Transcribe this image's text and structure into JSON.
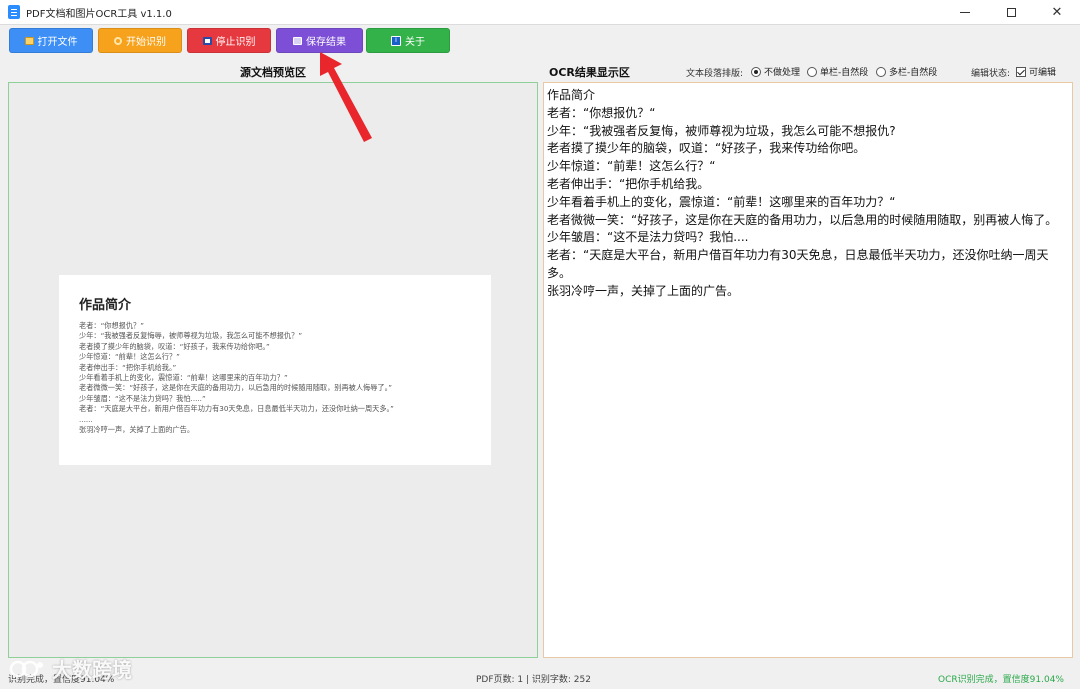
{
  "window": {
    "title": "PDF文档和图片OCR工具 v1.1.0"
  },
  "toolbar": {
    "open_label": "打开文件",
    "start_label": "开始识别",
    "stop_label": "停止识别",
    "save_label": "保存结果",
    "about_label": "关于"
  },
  "left_panel": {
    "title": "源文档预览区"
  },
  "right_panel": {
    "title": "OCR结果显示区",
    "paragraph_label": "文本段落排版:",
    "options": [
      "不做处理",
      "单栏-自然段",
      "多栏-自然段"
    ],
    "selected_option": "不做处理",
    "edit_label": "编辑状态:",
    "editable_label": "可编辑",
    "editable_checked": true,
    "lines": [
      "作品简介",
      "老者：“你想报仇？“",
      "少年：“我被强者反复悔，被师尊视为垃圾，我怎么可能不想报仇?",
      "老者摸了摸少年的脑袋，叹道：“好孩子，我来传功给你吧。",
      "少年惊道：“前辈！这怎么行？“",
      "老者伸出手：“把你手机给我。",
      "少年看着手机上的变化，震惊道：“前辈！这哪里来的百年功力？“",
      "老者微微一笑：“好孩子，这是你在天庭的备用功力，以后急用的时候随用随取，别再被人悔了。",
      "少年皱眉：“这不是法力贷吗？我怕....",
      "老者：“天庭是大平台，新用户借百年功力有30天免息，日息最低半天功力，还没你吐纳一周天多。",
      "张羽冷哼一声，关掉了上面的广告。"
    ]
  },
  "preview_doc": {
    "title": "作品简介",
    "lines": [
      "老者：“你想报仇？”",
      "少年：“我被强者反复悔辱，被师尊视为垃圾，我怎么可能不想报仇？”",
      "老者摸了摸少年的脑袋，叹道：“好孩子，我来传功给你吧。”",
      "少年惊道：“前辈！这怎么行？”",
      "老者伸出手：“把你手机给我。”",
      "少年看着手机上的变化，震惊道：“前辈！这哪里来的百年功力？”",
      "老者微微一笑：“好孩子，这是你在天庭的备用功力，以后急用的时候随用随取，别再被人侮辱了。”",
      "少年皱眉：“这不是法力贷吗？我怕.....”",
      "老者：“天庭是大平台，新用户借百年功力有30天免息，日息最低半天功力，还没你吐纳一周天多。”",
      "......",
      "张羽冷哼一声，关掉了上面的广告。"
    ]
  },
  "statusbar": {
    "left": "识别完成，置信度91.04%",
    "middle": "PDF页数: 1 | 识别字数: 252",
    "right": "OCR识别完成，置信度91.04%"
  },
  "watermark": {
    "text": "大数跨境"
  },
  "colors": {
    "open": "#3d8ef5",
    "start": "#f6a21c",
    "stop": "#e6393f",
    "save": "#7d4fd6",
    "about": "#33b24a",
    "arrow": "#e8262c",
    "status_ok": "#2aa84a"
  }
}
